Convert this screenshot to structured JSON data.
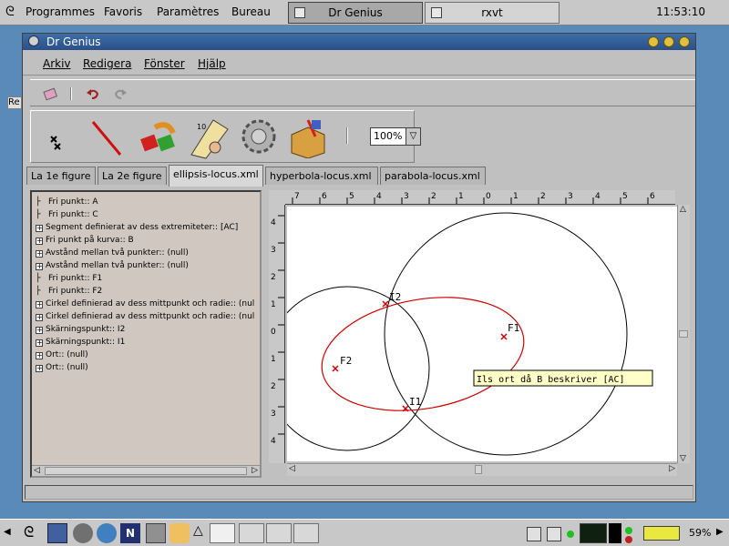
{
  "top_panel": {
    "menu": [
      "Programmes",
      "Favoris",
      "Paramètres",
      "Bureau"
    ],
    "tasks": [
      {
        "label": "Dr Genius",
        "active": true
      },
      {
        "label": "rxvt",
        "active": false
      }
    ],
    "clock": "11:53:10"
  },
  "side_tag": "Re",
  "window": {
    "title": "Dr Genius",
    "menu": [
      "Arkiv",
      "Redigera",
      "Fönster",
      "Hjälp"
    ],
    "zoom": "100%",
    "tabs": [
      {
        "label": "La 1e figure",
        "active": false
      },
      {
        "label": "La 2e figure",
        "active": false
      },
      {
        "label": "ellipsis-locus.xml",
        "active": true
      },
      {
        "label": "hyperbola-locus.xml",
        "active": false
      },
      {
        "label": "parabola-locus.xml",
        "active": false
      }
    ],
    "tree": [
      {
        "text": "Fri punkt:: A",
        "expandable": false
      },
      {
        "text": "Fri punkt:: C",
        "expandable": false
      },
      {
        "text": "Segment definierat av dess extremiteter:: [AC]",
        "expandable": true
      },
      {
        "text": "Fri punkt på kurva:: B",
        "expandable": true
      },
      {
        "text": "Avstånd mellan två punkter:: (null)",
        "expandable": true
      },
      {
        "text": "Avstånd mellan två punkter:: (null)",
        "expandable": true
      },
      {
        "text": "Fri punkt:: F1",
        "expandable": false
      },
      {
        "text": "Fri punkt:: F2",
        "expandable": false
      },
      {
        "text": "Cirkel definierad av dess mittpunkt och radie:: (nul",
        "expandable": true
      },
      {
        "text": "Cirkel definierad av dess mittpunkt och radie:: (nul",
        "expandable": true
      },
      {
        "text": "Skärningspunkt:: I2",
        "expandable": true
      },
      {
        "text": "Skärningspunkt:: I1",
        "expandable": true
      },
      {
        "text": "Ort:: (null)",
        "expandable": true
      },
      {
        "text": "Ort:: (null)",
        "expandable": true
      }
    ],
    "ruler_h": [
      "7",
      "6",
      "5",
      "4",
      "3",
      "2",
      "1",
      "0",
      "1",
      "2",
      "3",
      "4",
      "5",
      "6"
    ],
    "ruler_v": [
      "4",
      "3",
      "2",
      "1",
      "0",
      "1",
      "2",
      "3",
      "4"
    ],
    "points": {
      "F1": "F1",
      "F2": "F2",
      "I1": "I1",
      "I2": "I2"
    },
    "tooltip": "Ils ort då B beskriver [AC]",
    "colors": {
      "locus": "#cc0000",
      "circle": "#000000",
      "title": "#2f5a95"
    }
  },
  "bottom_panel": {
    "battery": "59%",
    "icons": [
      "gnome-foot-icon",
      "monitor-icon",
      "gimp-icon",
      "globe-icon",
      "netscape-icon",
      "printer-icon",
      "hand-icon"
    ]
  }
}
